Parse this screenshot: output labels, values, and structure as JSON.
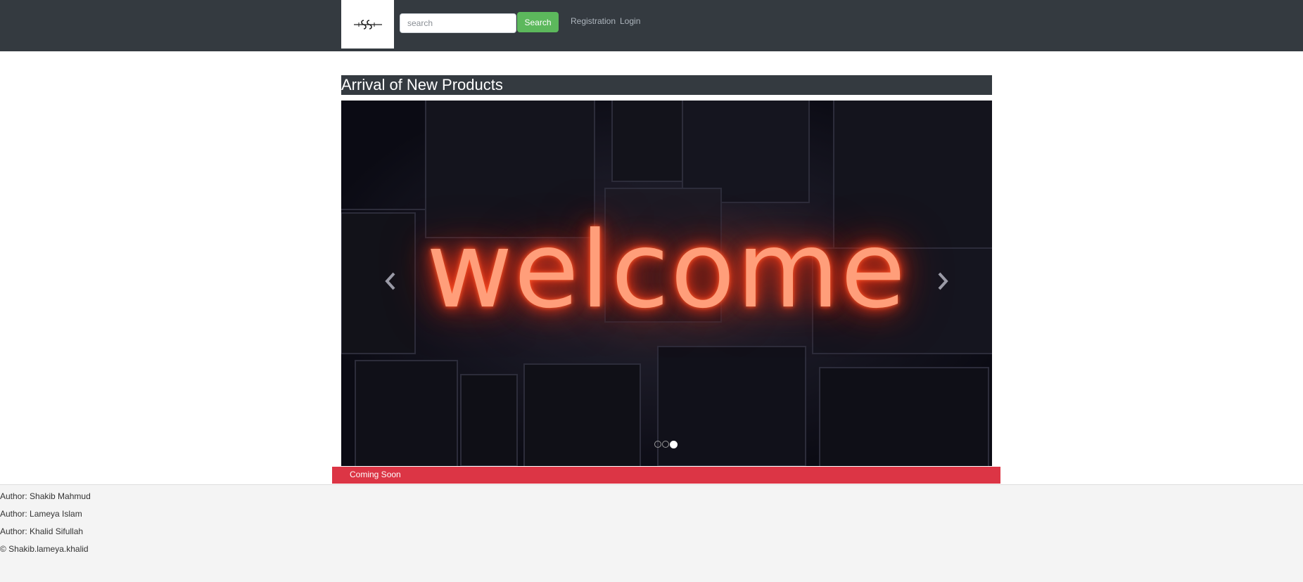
{
  "header": {
    "logo_alt": "logo",
    "search": {
      "placeholder": "search",
      "value": ""
    },
    "search_button": "Search",
    "nav_links": [
      "Registration",
      "Login"
    ]
  },
  "main": {
    "section_title": "Arrival of New Products",
    "carousel": {
      "slide_text": "welcome",
      "indicator_count": 3,
      "active_index": 2
    },
    "coming_soon": "Coming Soon"
  },
  "footer": {
    "authors": [
      "Author: Shakib Mahmud",
      "Author: Lameya Islam",
      "Author: Khalid Sifullah"
    ],
    "copyright": "© Shakib.lameya.khalid"
  },
  "colors": {
    "navbar": "#343a40",
    "search_button": "#5cb85c",
    "coming_soon_bar": "#dc3545",
    "footer": "#f4f4f4"
  }
}
